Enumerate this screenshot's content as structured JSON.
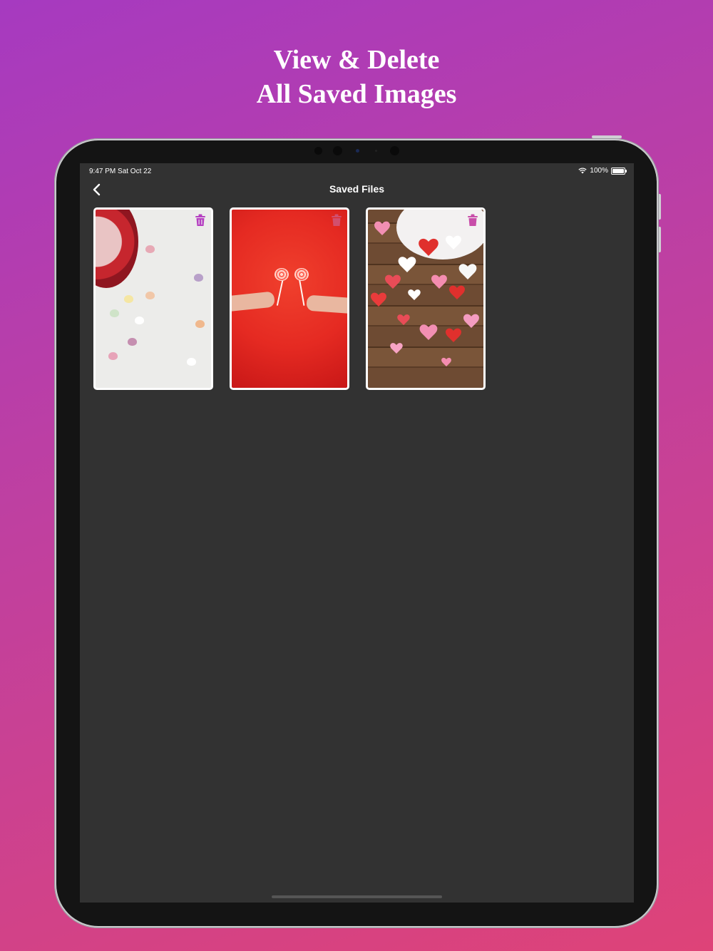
{
  "headline": {
    "line1": "View & Delete",
    "line2": "All Saved Images"
  },
  "status_bar": {
    "time_date": "9:47 PM   Sat Oct 22",
    "battery": "100%"
  },
  "nav": {
    "title": "Saved Files"
  },
  "colors": {
    "accent_trash": "#b53fc1",
    "screen_bg": "#323232"
  },
  "saved_images": [
    {
      "subject": "candy hearts on white table"
    },
    {
      "subject": "two hands holding heart lollipops on red"
    },
    {
      "subject": "paper hearts on wooden table"
    }
  ]
}
